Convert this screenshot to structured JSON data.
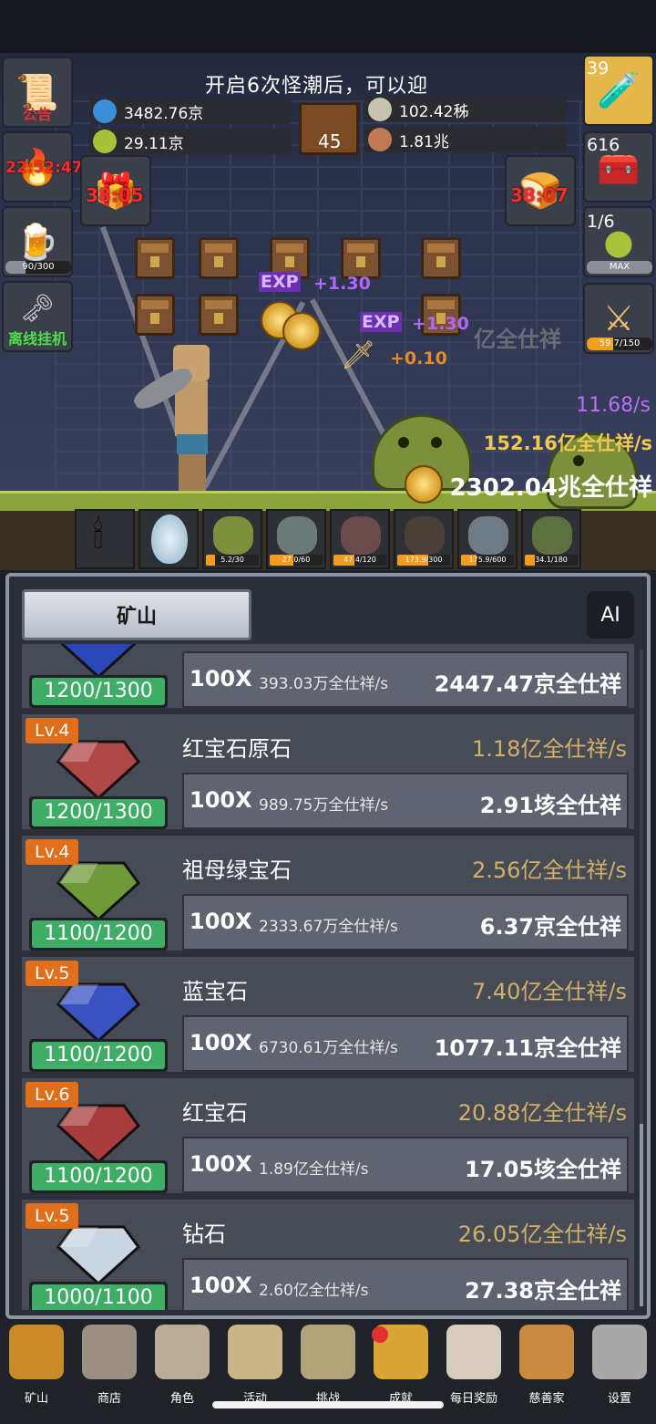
{
  "banner": "开启6次怪潮后，可以迎",
  "left_buttons": {
    "notice": "公告",
    "torch_timer": "22:52:47",
    "beer_progress": "90/300",
    "beer_fill": 0.3,
    "offline": "离线挂机"
  },
  "resources": {
    "blue_potion": "3482.76京",
    "green_potion": "29.11京",
    "book_level": "45",
    "silver": "102.42秭",
    "meat": "1.81兆"
  },
  "chest_timers": {
    "left": "38:05",
    "right": "38:07"
  },
  "right_buttons": {
    "potion_count": "39",
    "chest_count": "616",
    "slime_count": "1/6",
    "slime_max": "MAX",
    "sword_progress": "59.7/150",
    "sword_fill": 0.398
  },
  "floating": {
    "exp1": "EXP",
    "exp1_val": "+1.30",
    "exp2": "EXP",
    "exp2_val": "+1.30",
    "plus": "+0.10",
    "ghost": "亿全仕祥"
  },
  "stats": {
    "speed": "11.68/s",
    "income_rate": "152.16亿全仕祥/s",
    "total": "2302.04兆全仕祥"
  },
  "monsters": [
    {
      "name": "slime",
      "progress": "5.2/30",
      "fill": 0.17,
      "color": "#7c8f3a"
    },
    {
      "name": "zombie",
      "progress": "27.0/60",
      "fill": 0.45,
      "color": "#6b7a78"
    },
    {
      "name": "bat",
      "progress": "47.4/120",
      "fill": 0.4,
      "color": "#6a4a4a"
    },
    {
      "name": "spider",
      "progress": "173.9/300",
      "fill": 0.58,
      "color": "#4a4038"
    },
    {
      "name": "mummy",
      "progress": "175.9/600",
      "fill": 0.29,
      "color": "#6f7b84"
    },
    {
      "name": "goblin",
      "progress": "34.1/180",
      "fill": 0.19,
      "color": "#5e7040"
    }
  ],
  "mine": {
    "title": "矿山",
    "ai": "AI",
    "rows": [
      {
        "lv": "",
        "name": "",
        "rate": "",
        "cap": "1200/1300",
        "mult": "100X",
        "inc": "393.03万全仕祥/s",
        "cost": "2447.47京全仕祥",
        "gem_color": "#2b47b8"
      },
      {
        "lv": "Lv.4",
        "name": "红宝石原石",
        "rate": "1.18亿全仕祥/s",
        "cap": "1200/1300",
        "mult": "100X",
        "inc": "989.75万全仕祥/s",
        "cost": "2.91垓全仕祥",
        "gem_color": "#b04747"
      },
      {
        "lv": "Lv.4",
        "name": "祖母绿宝石",
        "rate": "2.56亿全仕祥/s",
        "cap": "1100/1200",
        "mult": "100X",
        "inc": "2333.67万全仕祥/s",
        "cost": "6.37京全仕祥",
        "gem_color": "#6f9a3a"
      },
      {
        "lv": "Lv.5",
        "name": "蓝宝石",
        "rate": "7.40亿全仕祥/s",
        "cap": "1100/1200",
        "mult": "100X",
        "inc": "6730.61万全仕祥/s",
        "cost": "1077.11京全仕祥",
        "gem_color": "#3852c2"
      },
      {
        "lv": "Lv.6",
        "name": "红宝石",
        "rate": "20.88亿全仕祥/s",
        "cap": "1100/1200",
        "mult": "100X",
        "inc": "1.89亿全仕祥/s",
        "cost": "17.05垓全仕祥",
        "gem_color": "#a83c3c"
      },
      {
        "lv": "Lv.5",
        "name": "钻石",
        "rate": "26.05亿全仕祥/s",
        "cap": "1000/1100",
        "mult": "100X",
        "inc": "2.60亿全仕祥/s",
        "cost": "27.38京全仕祥",
        "gem_color": "#c9d6e2"
      }
    ]
  },
  "nav": [
    {
      "label": "矿山",
      "icon": "lantern-icon",
      "color": "#c98b2a"
    },
    {
      "label": "商店",
      "icon": "shell-icon",
      "color": "#9a8f80"
    },
    {
      "label": "角色",
      "icon": "skull-icon",
      "color": "#b9ad98"
    },
    {
      "label": "活动",
      "icon": "scroll-icon",
      "color": "#c9b58a"
    },
    {
      "label": "挑战",
      "icon": "map-icon",
      "color": "#b3a27a"
    },
    {
      "label": "成就",
      "icon": "key-icon",
      "color": "#d9a535"
    },
    {
      "label": "每日奖励",
      "icon": "envelope-icon",
      "color": "#d8cdbd"
    },
    {
      "label": "慈善家",
      "icon": "bread-icon",
      "color": "#c98a3f"
    },
    {
      "label": "设置",
      "icon": "gear-icon",
      "color": "#a8a8a8"
    }
  ]
}
